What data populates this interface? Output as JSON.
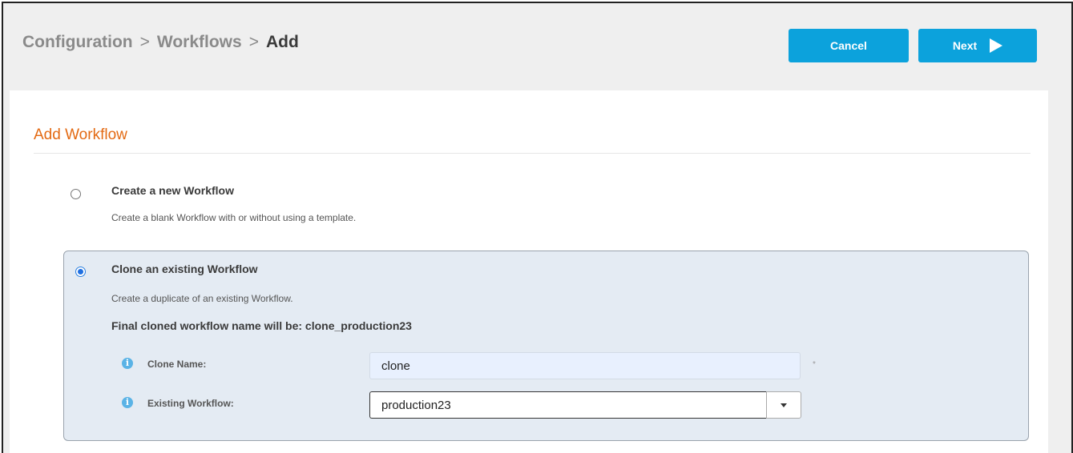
{
  "breadcrumb": {
    "items": [
      "Configuration",
      "Workflows"
    ],
    "current": "Add",
    "separator": ">"
  },
  "buttons": {
    "cancel_label": "Cancel",
    "next_label": "Next"
  },
  "section": {
    "title": "Add Workflow"
  },
  "options": {
    "create_new": {
      "title": "Create a new Workflow",
      "description": "Create a blank Workflow with or without using a template.",
      "selected": false
    },
    "clone_existing": {
      "title": "Clone an existing Workflow",
      "description": "Create a duplicate of an existing Workflow.",
      "selected": true,
      "final_name_text": "Final cloned workflow name will be: clone_production23",
      "clone_name": {
        "label": "Clone Name:",
        "value": "clone",
        "required_mark": "*"
      },
      "existing_workflow": {
        "label": "Existing Workflow:",
        "value": "production23"
      }
    }
  },
  "icons": {
    "info": "info-icon",
    "next": "play-icon",
    "dropdown": "caret-down-icon"
  },
  "colors": {
    "accent_button": "#0ca2dc",
    "section_title": "#e36a13",
    "clone_box_bg": "#e4ebf3",
    "info_icon": "#5ab3e6"
  }
}
